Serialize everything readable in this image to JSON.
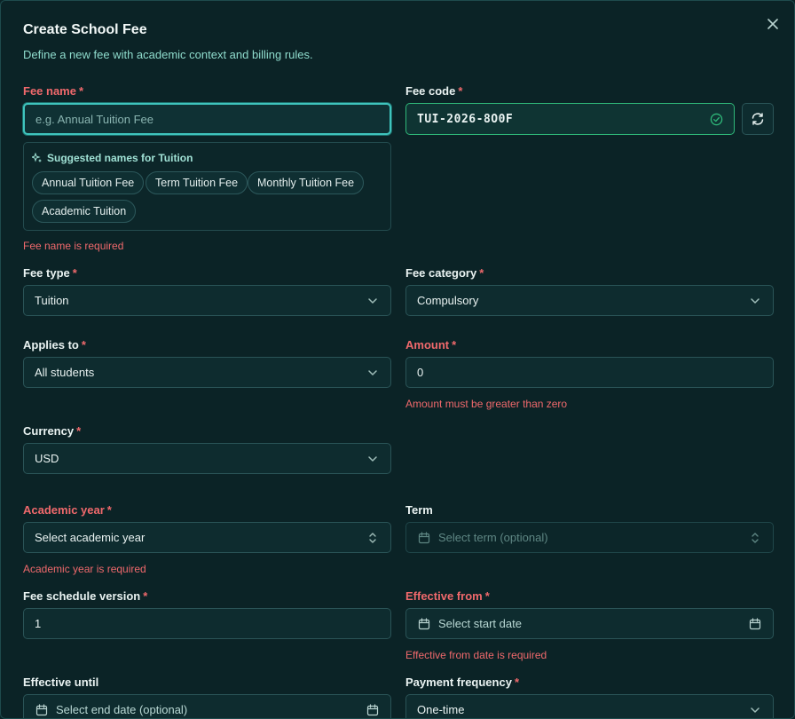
{
  "dialog": {
    "title": "Create School Fee",
    "subtitle": "Define a new fee with academic context and billing rules."
  },
  "fee_name": {
    "label": "Fee name",
    "required_mark": "*",
    "value": "",
    "placeholder": "e.g. Annual Tuition Fee",
    "error": "Fee name is required"
  },
  "suggestions": {
    "heading": "Suggested names for Tuition",
    "chips": [
      "Annual Tuition Fee",
      "Term Tuition Fee",
      "Monthly Tuition Fee",
      "Academic Tuition"
    ]
  },
  "fee_code": {
    "label": "Fee code",
    "required_mark": "*",
    "value": "TUI-2026-8O0F"
  },
  "fee_type": {
    "label": "Fee type",
    "required_mark": "*",
    "value": "Tuition"
  },
  "fee_category": {
    "label": "Fee category",
    "required_mark": "*",
    "value": "Compulsory"
  },
  "applies_to": {
    "label": "Applies to",
    "required_mark": "*",
    "value": "All students"
  },
  "amount": {
    "label": "Amount",
    "required_mark": "*",
    "value": "0",
    "error": "Amount must be greater than zero"
  },
  "currency": {
    "label": "Currency",
    "required_mark": "*",
    "value": "USD"
  },
  "academic_year": {
    "label": "Academic year",
    "required_mark": "*",
    "value": "Select academic year",
    "error": "Academic year is required"
  },
  "term": {
    "label": "Term",
    "value": "Select term (optional)"
  },
  "schedule_version": {
    "label": "Fee schedule version",
    "required_mark": "*",
    "value": "1"
  },
  "effective_from": {
    "label": "Effective from",
    "required_mark": "*",
    "value": "Select start date",
    "error": "Effective from date is required"
  },
  "effective_until": {
    "label": "Effective until",
    "value": "Select end date (optional)"
  },
  "payment_frequency": {
    "label": "Payment frequency",
    "required_mark": "*",
    "value": "One-time"
  },
  "icons": {
    "close": "close-icon",
    "check": "check-circle-icon",
    "refresh": "refresh-icon",
    "sparkle": "sparkles-icon",
    "chevron": "chevron-down-icon",
    "updown": "chevrons-up-down-icon",
    "calendar": "calendar-icon"
  },
  "colors": {
    "background": "#0b2326",
    "accent": "#3fc4bd",
    "success": "#2fb879",
    "error": "#f0696c"
  }
}
